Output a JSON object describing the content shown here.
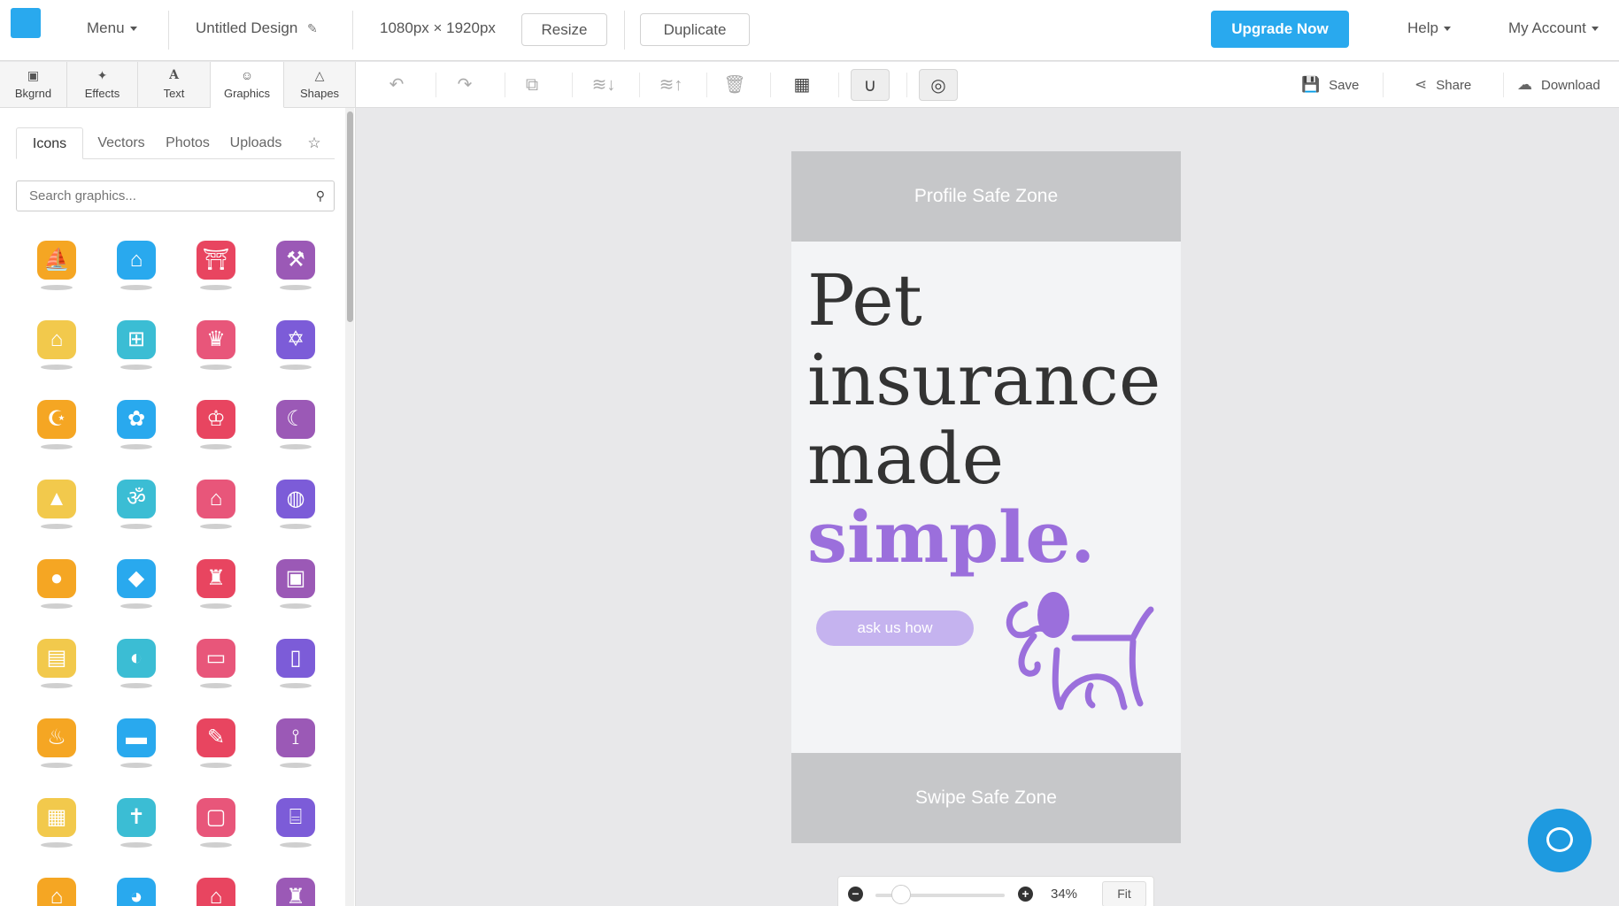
{
  "topbar": {
    "menu_label": "Menu",
    "design_title": "Untitled Design",
    "dimensions": "1080px × 1920px",
    "resize_label": "Resize",
    "duplicate_label": "Duplicate",
    "upgrade_label": "Upgrade Now",
    "help_label": "Help",
    "account_label": "My Account",
    "accent_color": "#29a9ee"
  },
  "tooltabs": [
    {
      "label": "Bkgrnd",
      "icon": "image-icon"
    },
    {
      "label": "Effects",
      "icon": "wand-icon"
    },
    {
      "label": "Text",
      "icon": "text-icon"
    },
    {
      "label": "Graphics",
      "icon": "smiley-icon",
      "active": true
    },
    {
      "label": "Shapes",
      "icon": "triangle-icon"
    }
  ],
  "actions": {
    "save_label": "Save",
    "share_label": "Share",
    "download_label": "Download"
  },
  "library": {
    "tabs": [
      "Icons",
      "Vectors",
      "Photos",
      "Uploads"
    ],
    "active_tab": "Icons",
    "search_placeholder": "Search graphics...",
    "items": [
      "boat-icon",
      "temple-icon",
      "torii-gate-icon",
      "hammer-icon",
      "pagoda-icon",
      "ladder-icon",
      "palace-icon",
      "star-of-david-icon",
      "crescent-star-icon",
      "cherry-blossom-icon",
      "crown-icon",
      "moon-hand-icon",
      "pyramids-icon",
      "om-icon",
      "pagoda-tower-icon",
      "planet-icon",
      "ninja-icon",
      "map-shape-icon",
      "kremlin-icon",
      "picture-frame-icon",
      "book-icon",
      "dolphin-icon",
      "coffee-cup-icon",
      "toast-icon",
      "hookah-icon",
      "car-icon",
      "feather-icon",
      "eiffel-tower-icon",
      "easel-icon",
      "cross-icon",
      "jar-icon",
      "colosseum-icon",
      "temple-roof-icon",
      "monkey-icon",
      "house-icon",
      "castle-icon"
    ]
  },
  "canvas": {
    "top_zone": "Profile Safe Zone",
    "bottom_zone": "Swipe Safe Zone",
    "headline_lines": [
      "Pet",
      "insurance",
      "made"
    ],
    "headline_accent": "simple.",
    "cta": "ask us how",
    "accent_color": "#9b6fdc"
  },
  "zoom": {
    "percent": "34%",
    "fit_label": "Fit",
    "level": 0.34
  }
}
